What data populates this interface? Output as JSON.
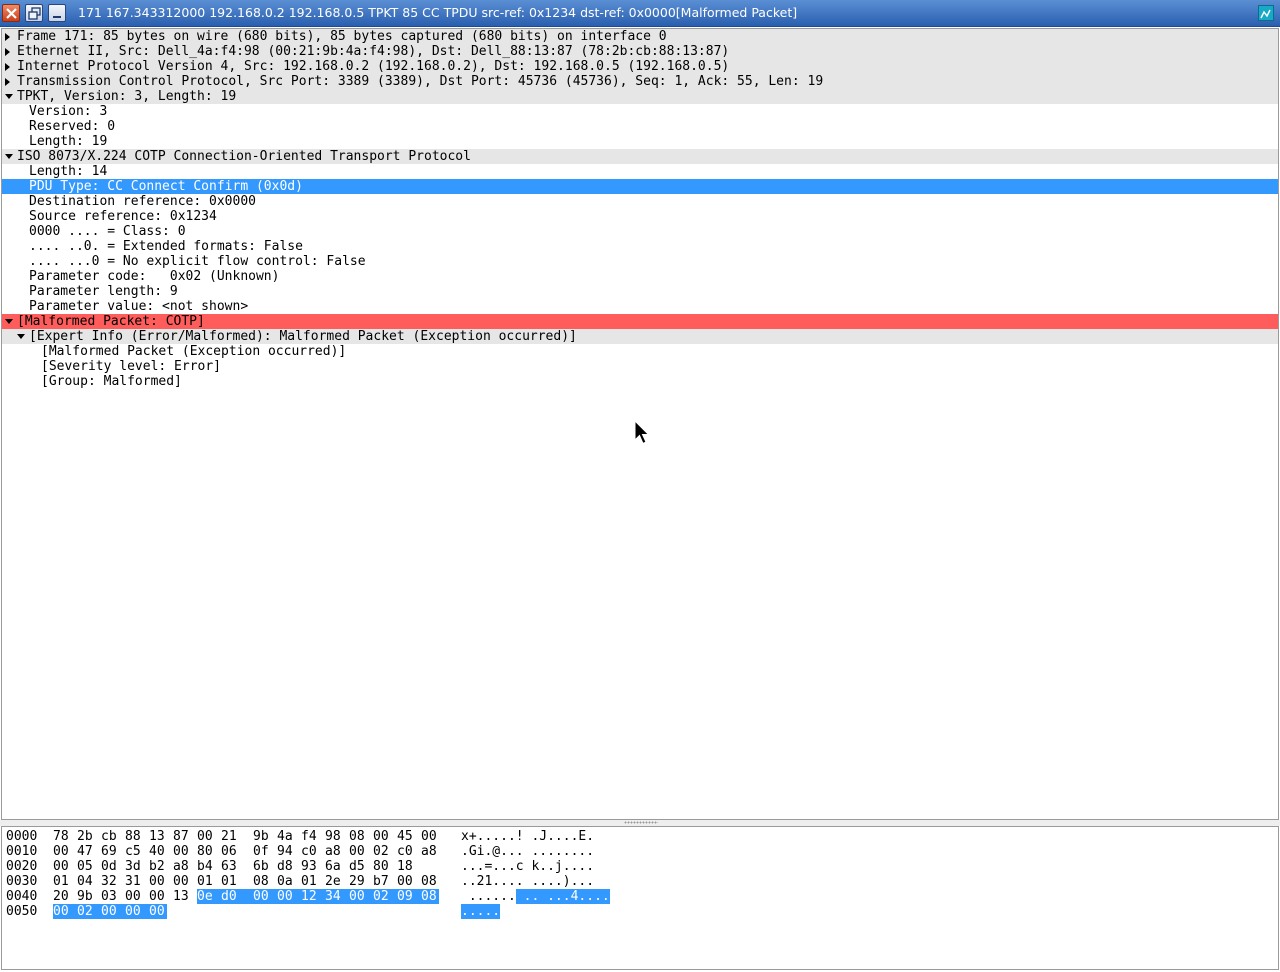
{
  "window": {
    "title": "171 167.343312000 192.168.0.2 192.168.0.5 TPKT 85 CC TPDU src-ref: 0x1234 dst-ref: 0x0000[Malformed Packet]"
  },
  "tree": [
    {
      "text": "Frame 171: 85 bytes on wire (680 bits), 85 bytes captured (680 bits) on interface 0",
      "indent": 0,
      "arrow": "right",
      "style": "bg"
    },
    {
      "text": "Ethernet II, Src: Dell_4a:f4:98 (00:21:9b:4a:f4:98), Dst: Dell_88:13:87 (78:2b:cb:88:13:87)",
      "indent": 0,
      "arrow": "right",
      "style": "bg"
    },
    {
      "text": "Internet Protocol Version 4, Src: 192.168.0.2 (192.168.0.2), Dst: 192.168.0.5 (192.168.0.5)",
      "indent": 0,
      "arrow": "right",
      "style": "bg"
    },
    {
      "text": "Transmission Control Protocol, Src Port: 3389 (3389), Dst Port: 45736 (45736), Seq: 1, Ack: 55, Len: 19",
      "indent": 0,
      "arrow": "right",
      "style": "bg"
    },
    {
      "text": "TPKT, Version: 3, Length: 19",
      "indent": 0,
      "arrow": "down",
      "style": "bg"
    },
    {
      "text": "Version: 3",
      "indent": 1,
      "arrow": "",
      "style": ""
    },
    {
      "text": "Reserved: 0",
      "indent": 1,
      "arrow": "",
      "style": ""
    },
    {
      "text": "Length: 19",
      "indent": 1,
      "arrow": "",
      "style": ""
    },
    {
      "text": "ISO 8073/X.224 COTP Connection-Oriented Transport Protocol",
      "indent": 0,
      "arrow": "down",
      "style": "bg"
    },
    {
      "text": "Length: 14",
      "indent": 1,
      "arrow": "",
      "style": ""
    },
    {
      "text": "PDU Type: CC Connect Confirm (0x0d)",
      "indent": 1,
      "arrow": "",
      "style": "sel"
    },
    {
      "text": "Destination reference: 0x0000",
      "indent": 1,
      "arrow": "",
      "style": ""
    },
    {
      "text": "Source reference: 0x1234",
      "indent": 1,
      "arrow": "",
      "style": ""
    },
    {
      "text": "0000 .... = Class: 0",
      "indent": 1,
      "arrow": "",
      "style": ""
    },
    {
      "text": ".... ..0. = Extended formats: False",
      "indent": 1,
      "arrow": "",
      "style": ""
    },
    {
      "text": ".... ...0 = No explicit flow control: False",
      "indent": 1,
      "arrow": "",
      "style": ""
    },
    {
      "text": "Parameter code:   0x02 (Unknown)",
      "indent": 1,
      "arrow": "",
      "style": ""
    },
    {
      "text": "Parameter length: 9",
      "indent": 1,
      "arrow": "",
      "style": ""
    },
    {
      "text": "Parameter value: <not shown>",
      "indent": 1,
      "arrow": "",
      "style": ""
    },
    {
      "text": "[Malformed Packet: COTP]",
      "indent": 0,
      "arrow": "down",
      "style": "err"
    },
    {
      "text": "[Expert Info (Error/Malformed): Malformed Packet (Exception occurred)]",
      "indent": 1,
      "arrow": "down",
      "style": "bg"
    },
    {
      "text": "[Malformed Packet (Exception occurred)]",
      "indent": 2,
      "arrow": "",
      "style": ""
    },
    {
      "text": "[Severity level: Error]",
      "indent": 2,
      "arrow": "",
      "style": ""
    },
    {
      "text": "[Group: Malformed]",
      "indent": 2,
      "arrow": "",
      "style": ""
    }
  ],
  "hex": [
    {
      "offset": "0000",
      "bytes": [
        "78",
        "2b",
        "cb",
        "88",
        "13",
        "87",
        "00",
        "21",
        "9b",
        "4a",
        "f4",
        "98",
        "08",
        "00",
        "45",
        "00"
      ],
      "ascii": "x+.....! .J....E.",
      "hl_from": -1
    },
    {
      "offset": "0010",
      "bytes": [
        "00",
        "47",
        "69",
        "c5",
        "40",
        "00",
        "80",
        "06",
        "0f",
        "94",
        "c0",
        "a8",
        "00",
        "02",
        "c0",
        "a8"
      ],
      "ascii": ".Gi.@... ........",
      "hl_from": -1
    },
    {
      "offset": "0020",
      "bytes": [
        "00",
        "05",
        "0d",
        "3d",
        "b2",
        "a8",
        "b4",
        "63",
        "6b",
        "d8",
        "93",
        "6a",
        "d5",
        "80",
        "18"
      ],
      "ascii": "...=...c k..j....",
      "hl_from": -1
    },
    {
      "offset": "0030",
      "bytes": [
        "01",
        "04",
        "32",
        "31",
        "00",
        "00",
        "01",
        "01",
        "08",
        "0a",
        "01",
        "2e",
        "29",
        "b7",
        "00",
        "08"
      ],
      "ascii": "..21.... ....)...",
      "hl_from": -1
    },
    {
      "offset": "0040",
      "bytes": [
        "20",
        "9b",
        "03",
        "00",
        "00",
        "13",
        "0e",
        "d0",
        "00",
        "00",
        "12",
        "34",
        "00",
        "02",
        "09",
        "08"
      ],
      "ascii": " ...... .. ...4....",
      "hl_from": 6
    },
    {
      "offset": "0050",
      "bytes": [
        "00",
        "02",
        "00",
        "00",
        "00"
      ],
      "ascii": ".....",
      "hl_from": 0
    }
  ]
}
